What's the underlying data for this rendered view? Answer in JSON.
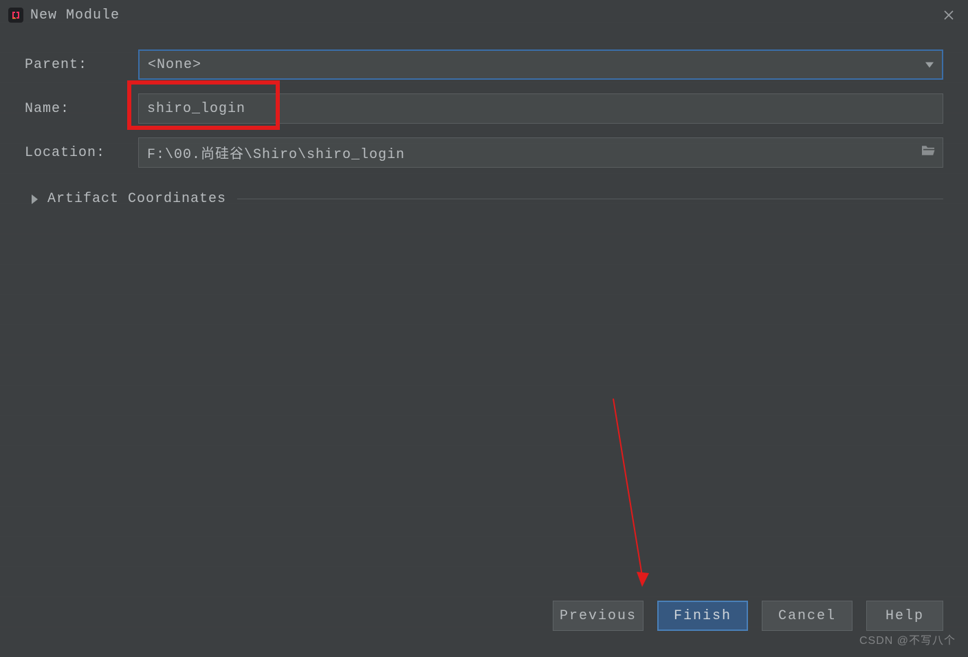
{
  "window": {
    "title": "New Module"
  },
  "labels": {
    "parent": "Parent:",
    "name": "Name:",
    "location": "Location:",
    "artifact": "Artifact Coordinates"
  },
  "fields": {
    "parent_value": "<None>",
    "name_value": "shiro_login",
    "location_value": "F:\\00.尚硅谷\\Shiro\\shiro_login"
  },
  "buttons": {
    "previous": "Previous",
    "finish": "Finish",
    "cancel": "Cancel",
    "help": "Help"
  },
  "watermark": "CSDN @不写八个"
}
